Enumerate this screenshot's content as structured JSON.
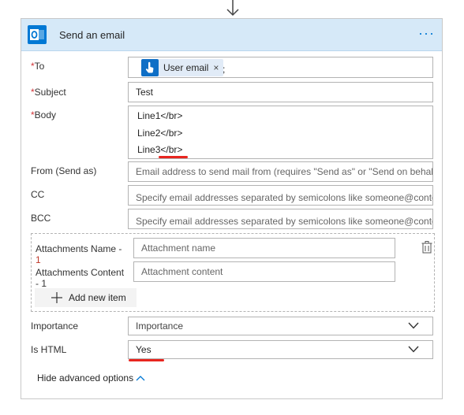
{
  "card": {
    "title": "Send an email",
    "more_label": "···",
    "accent_color": "#0078d4",
    "header_bg": "#d6e9f8"
  },
  "fields": {
    "to": {
      "req": "*",
      "label": "To",
      "token_label": "User email",
      "token_close": "×",
      "separator": ";"
    },
    "subject": {
      "req": "*",
      "label": "Subject",
      "value": "Test"
    },
    "body": {
      "req": "*",
      "label": "Body",
      "lines": [
        "Line1</br>",
        "Line2</br>",
        "Line3</br>"
      ]
    },
    "from": {
      "label": "From (Send as)",
      "placeholder": "Email address to send mail from (requires \"Send as\" or \"Send on behalf"
    },
    "cc": {
      "label": "CC",
      "placeholder": "Specify email addresses separated by semicolons like someone@contoso.com"
    },
    "bcc": {
      "label": "BCC",
      "placeholder": "Specify email addresses separated by semicolons like someone@contoso.com"
    }
  },
  "attachments": {
    "name_label_line1": "Attachments Name -",
    "name_label_line2": "1",
    "content_label_line1": "Attachments Content",
    "content_label_line2": "- 1",
    "name_placeholder": "Attachment name",
    "content_placeholder": "Attachment content",
    "add_item_label": "Add new item",
    "delete_icon": "trash-icon"
  },
  "importance": {
    "label": "Importance",
    "value": "Importance"
  },
  "is_html": {
    "label": "Is HTML",
    "value": "Yes"
  },
  "advanced": {
    "hide_label": "Hide advanced options"
  },
  "annotation_color": "#e8251f"
}
